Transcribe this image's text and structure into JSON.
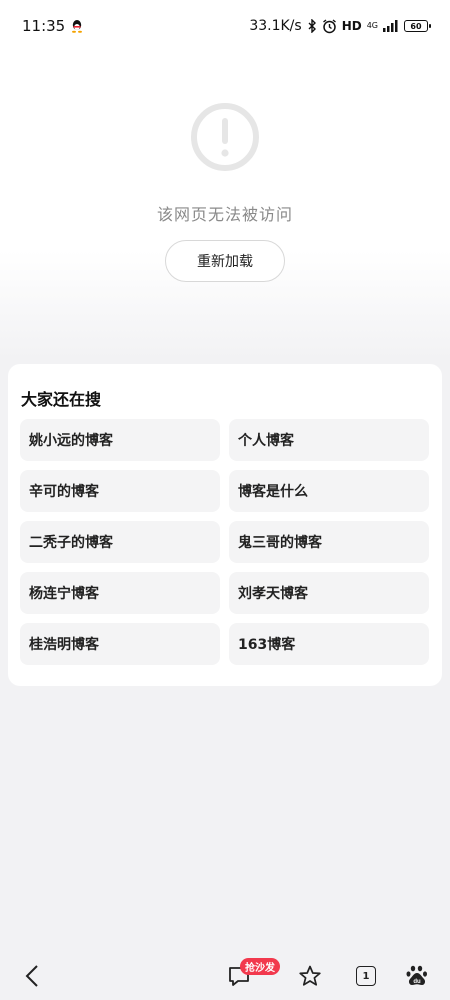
{
  "status_bar": {
    "time": "11:35",
    "net_speed": "33.1K/s",
    "hd": "HD",
    "network": "4G",
    "battery": "60"
  },
  "error": {
    "message": "该网页无法被访问",
    "reload_label": "重新加载"
  },
  "suggestions": {
    "title": "大家还在搜",
    "items": [
      "姚小远的博客",
      "个人博客",
      "辛可的博客",
      "博客是什么",
      "二秃子的博客",
      "鬼三哥的博客",
      "杨连宁博客",
      "刘孝天博客",
      "桂浩明博客",
      "163博客"
    ]
  },
  "bottom_nav": {
    "badge": "抢沙发",
    "tab_count": "1",
    "icons": [
      "back-icon",
      "comment-icon",
      "star-icon",
      "tabs-icon",
      "baidu-icon"
    ]
  }
}
